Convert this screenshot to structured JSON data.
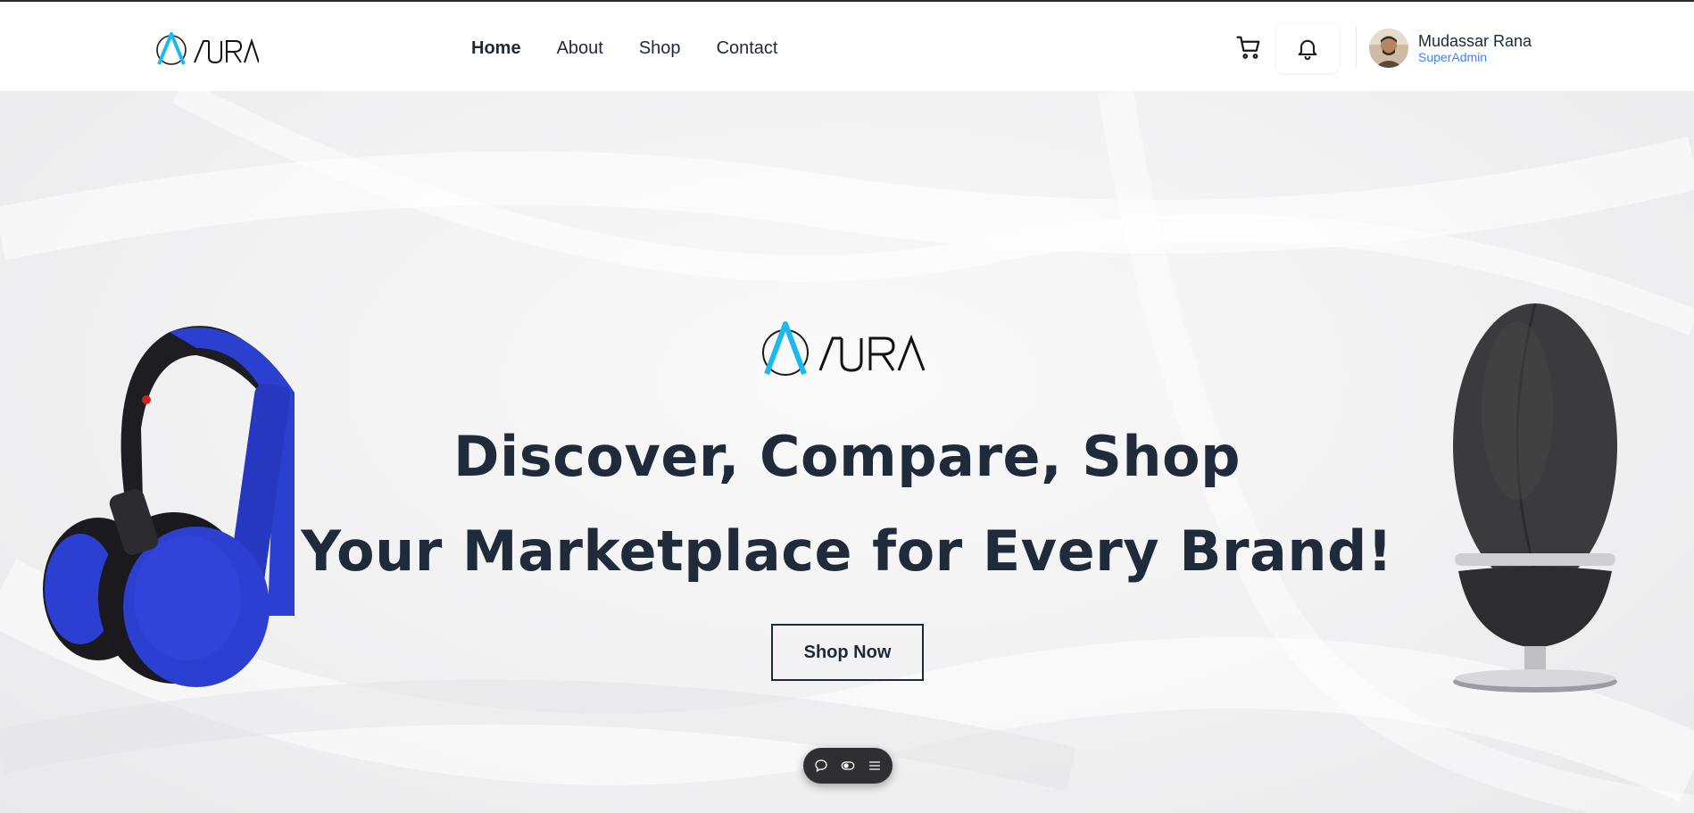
{
  "brand": {
    "name": "ΛURA",
    "accent_color": "#1cb8f0"
  },
  "nav": {
    "items": [
      {
        "label": "Home",
        "active": true
      },
      {
        "label": "About",
        "active": false
      },
      {
        "label": "Shop",
        "active": false
      },
      {
        "label": "Contact",
        "active": false
      }
    ]
  },
  "header": {
    "cart_icon": "shopping-cart-icon",
    "bell_icon": "bell-icon",
    "user": {
      "name": "Mudassar Rana",
      "role": "SuperAdmin"
    }
  },
  "hero": {
    "headline_line1": "Discover, Compare, Shop",
    "headline_line2": "Your Marketplace for Every Brand!",
    "cta_label": "Shop Now",
    "left_product": "headphones",
    "right_product": "speaker"
  },
  "floating_toolbar": {
    "icons": [
      "comment-icon",
      "toggle-icon",
      "menu-icon"
    ]
  },
  "colors": {
    "text_dark": "#1f2a3a",
    "role_blue": "#3b82f6",
    "headphone_blue": "#2b3fd1"
  }
}
